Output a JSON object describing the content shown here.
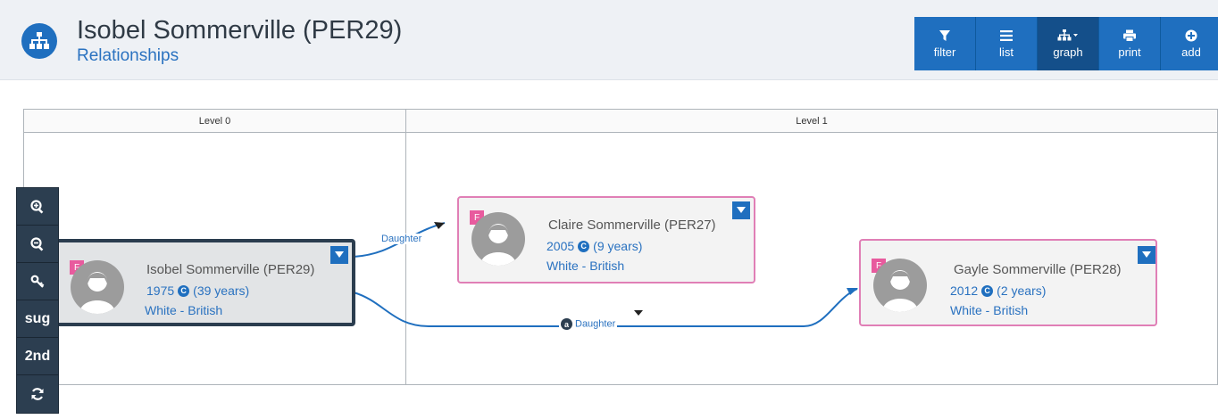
{
  "header": {
    "title": "Isobel Sommerville (PER29)",
    "subtitle": "Relationships",
    "icon": "sitemap-icon"
  },
  "toolbar": {
    "buttons": [
      {
        "label": "filter",
        "icon": "filter-icon"
      },
      {
        "label": "list",
        "icon": "list-icon"
      },
      {
        "label": "graph",
        "icon": "sitemap-dropdown-icon",
        "active": true
      },
      {
        "label": "print",
        "icon": "print-icon"
      },
      {
        "label": "add",
        "icon": "plus-circle-icon"
      }
    ]
  },
  "levels": [
    {
      "label": "Level 0"
    },
    {
      "label": "Level 1"
    }
  ],
  "zoom_bar": {
    "buttons": [
      {
        "label": "",
        "icon": "zoom-in-icon"
      },
      {
        "label": "",
        "icon": "zoom-out-icon"
      },
      {
        "label": "",
        "icon": "key-icon"
      },
      {
        "label": "sug"
      },
      {
        "label": "2nd"
      },
      {
        "label": "",
        "icon": "refresh-icon"
      }
    ]
  },
  "people": [
    {
      "gender": "F",
      "name": "Isobel Sommerville (PER29)",
      "dob_year": "1975",
      "age": "(39 years)",
      "ethnicity": "White - British",
      "selected": true
    },
    {
      "gender": "F",
      "name": "Claire Sommerville (PER27)",
      "dob_year": "2005",
      "age": "(9 years)",
      "ethnicity": "White - British"
    },
    {
      "gender": "F",
      "name": "Gayle Sommerville (PER28)",
      "dob_year": "2012",
      "age": "(2 years)",
      "ethnicity": "White - British"
    }
  ],
  "relationships": [
    {
      "label": "Daughter"
    },
    {
      "label": "Daughter",
      "badge": "a"
    }
  ],
  "colors": {
    "primary": "#1f6fbf",
    "dark": "#2c3e50",
    "female": "#e85b9e",
    "card_border_female": "#e07fb6",
    "edge": "#1f6fbf"
  }
}
